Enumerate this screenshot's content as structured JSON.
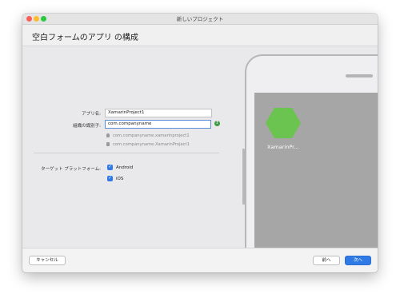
{
  "window": {
    "title": "新しいプロジェクト"
  },
  "header": {
    "title": "空白フォームのアプリ の構成"
  },
  "form": {
    "app_name_label": "アプリ名:",
    "app_name_value": "XamarinProject1",
    "org_id_label": "組織の識別子:",
    "org_id_value": "com.companyname",
    "help_glyph": "?",
    "android_package": "com.companyname.xamarinproject1",
    "ios_bundle": "com.companyname.XamarinProject1",
    "target_platforms_label": "ターゲット プラットフォーム:",
    "platforms": [
      {
        "label": "Android",
        "checked": true
      },
      {
        "label": "iOS",
        "checked": true
      }
    ],
    "check_glyph": "✓"
  },
  "preview": {
    "app_name": "XamarinPr..."
  },
  "footer": {
    "cancel": "キャンセル",
    "back": "前へ",
    "next": "次へ"
  },
  "colors": {
    "accent": "#2f7ae5",
    "app_icon": "#6cc450",
    "help": "#3f9a44"
  },
  "icons": [
    "android-icon",
    "apple-icon",
    "help-icon"
  ]
}
